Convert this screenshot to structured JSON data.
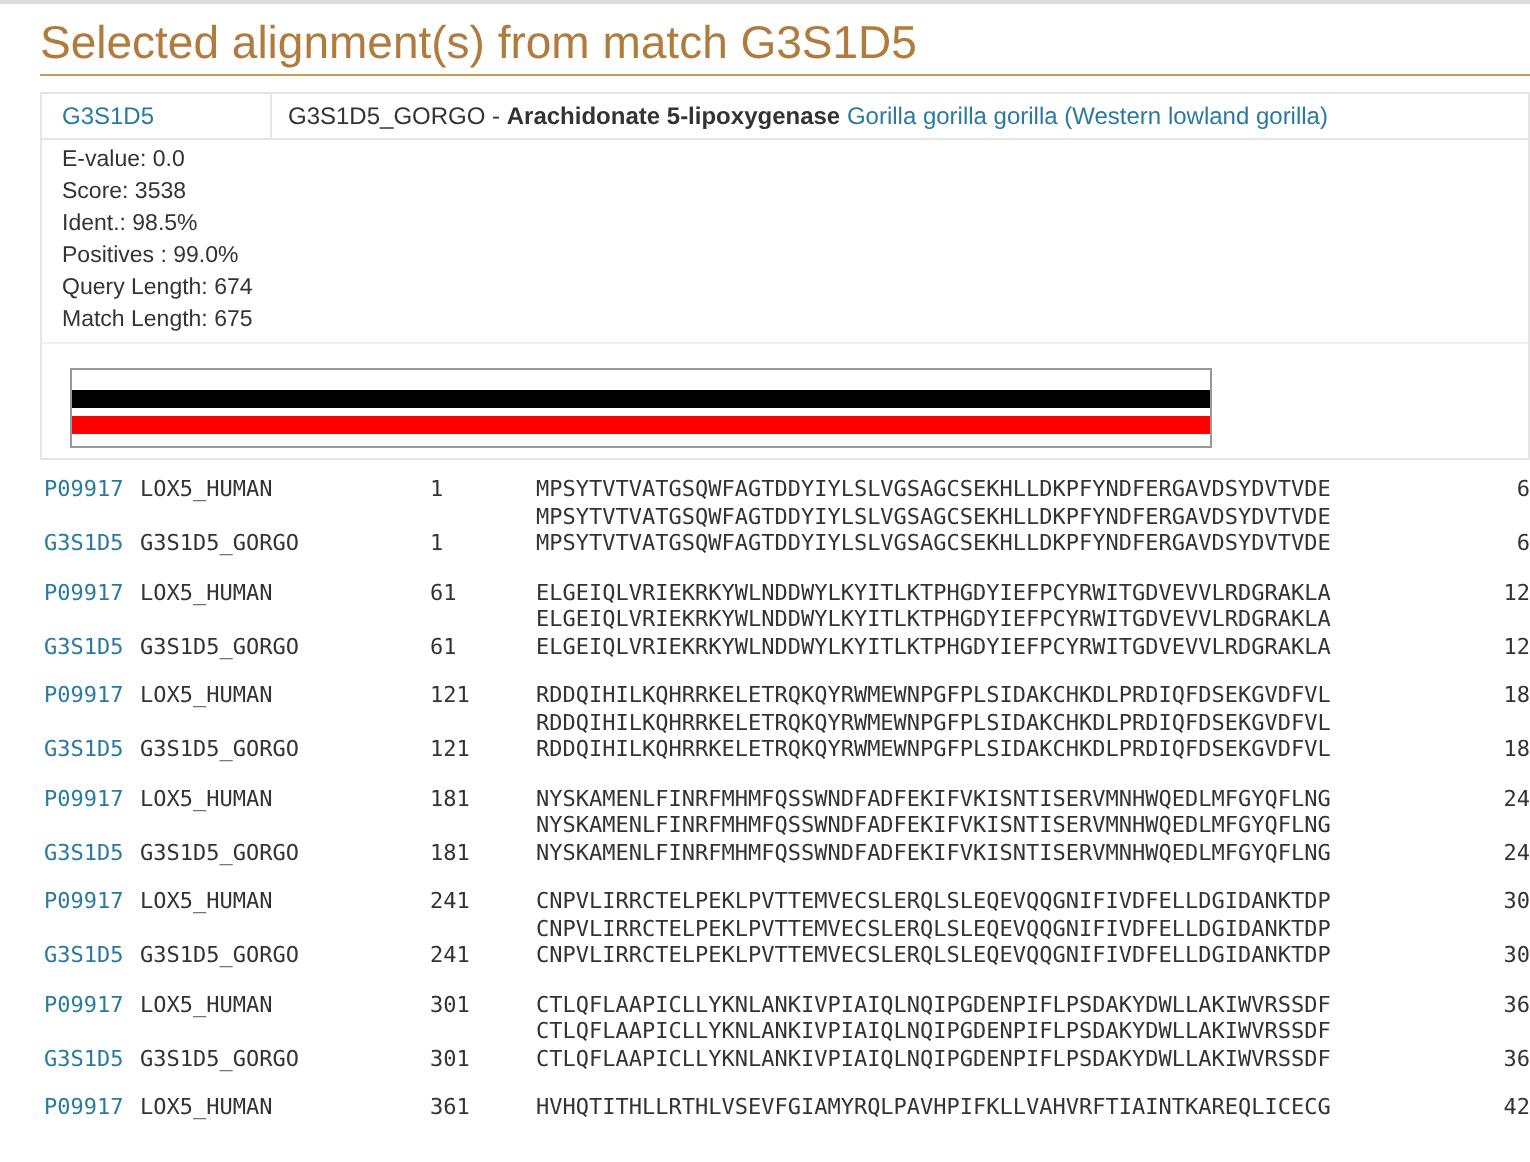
{
  "title": "Selected alignment(s) from match G3S1D5",
  "match": {
    "accession": "G3S1D5",
    "entry_name": "G3S1D5_GORGO",
    "separator": " - ",
    "protein": "Arachidonate 5-lipoxygenase",
    "organism": "Gorilla gorilla gorilla (Western lowland gorilla)"
  },
  "stats": [
    "E-value: 0.0",
    "Score: 3538",
    "Ident.: 98.5%",
    "Positives : 99.0%",
    "Query Length: 674",
    "Match Length: 675"
  ],
  "blocks": [
    {
      "query": {
        "accession": "P09917",
        "name": "LOX5_HUMAN",
        "start": "1",
        "sequence": "MPSYTVTVATGSQWFAGTDDYIYLSLVGSAGCSEKHLLDKPFYNDFERGAVDSYDVTVDE",
        "end": "6"
      },
      "middle": "MPSYTVTVATGSQWFAGTDDYIYLSLVGSAGCSEKHLLDKPFYNDFERGAVDSYDVTVDE",
      "match": {
        "accession": "G3S1D5",
        "name": "G3S1D5_GORGO",
        "start": "1",
        "sequence": "MPSYTVTVATGSQWFAGTDDYIYLSLVGSAGCSEKHLLDKPFYNDFERGAVDSYDVTVDE",
        "end": "6"
      }
    },
    {
      "query": {
        "accession": "P09917",
        "name": "LOX5_HUMAN",
        "start": "61",
        "sequence": "ELGEIQLVRIEKRKYWLNDDWYLKYITLKTPHGDYIEFPCYRWITGDVEVVLRDGRAKLA",
        "end": "12"
      },
      "middle": "ELGEIQLVRIEKRKYWLNDDWYLKYITLKTPHGDYIEFPCYRWITGDVEVVLRDGRAKLA",
      "match": {
        "accession": "G3S1D5",
        "name": "G3S1D5_GORGO",
        "start": "61",
        "sequence": "ELGEIQLVRIEKRKYWLNDDWYLKYITLKTPHGDYIEFPCYRWITGDVEVVLRDGRAKLA",
        "end": "12"
      }
    },
    {
      "query": {
        "accession": "P09917",
        "name": "LOX5_HUMAN",
        "start": "121",
        "sequence": "RDDQIHILKQHRRKELETRQKQYRWMEWNPGFPLSIDAKCHKDLPRDIQFDSEKGVDFVL",
        "end": "18"
      },
      "middle": "RDDQIHILKQHRRKELETRQKQYRWMEWNPGFPLSIDAKCHKDLPRDIQFDSEKGVDFVL",
      "match": {
        "accession": "G3S1D5",
        "name": "G3S1D5_GORGO",
        "start": "121",
        "sequence": "RDDQIHILKQHRRKELETRQKQYRWMEWNPGFPLSIDAKCHKDLPRDIQFDSEKGVDFVL",
        "end": "18"
      }
    },
    {
      "query": {
        "accession": "P09917",
        "name": "LOX5_HUMAN",
        "start": "181",
        "sequence": "NYSKAMENLFINRFMHMFQSSWNDFADFEKIFVKISNTISERVMNHWQEDLMFGYQFLNG",
        "end": "24"
      },
      "middle": "NYSKAMENLFINRFMHMFQSSWNDFADFEKIFVKISNTISERVMNHWQEDLMFGYQFLNG",
      "match": {
        "accession": "G3S1D5",
        "name": "G3S1D5_GORGO",
        "start": "181",
        "sequence": "NYSKAMENLFINRFMHMFQSSWNDFADFEKIFVKISNTISERVMNHWQEDLMFGYQFLNG",
        "end": "24"
      }
    },
    {
      "query": {
        "accession": "P09917",
        "name": "LOX5_HUMAN",
        "start": "241",
        "sequence": "CNPVLIRRCTELPEKLPVTTEMVECSLERQLSLEQEVQQGNIFIVDFELLDGIDANKTDP",
        "end": "30"
      },
      "middle": "CNPVLIRRCTELPEKLPVTTEMVECSLERQLSLEQEVQQGNIFIVDFELLDGIDANKTDP",
      "match": {
        "accession": "G3S1D5",
        "name": "G3S1D5_GORGO",
        "start": "241",
        "sequence": "CNPVLIRRCTELPEKLPVTTEMVECSLERQLSLEQEVQQGNIFIVDFELLDGIDANKTDP",
        "end": "30"
      }
    },
    {
      "query": {
        "accession": "P09917",
        "name": "LOX5_HUMAN",
        "start": "301",
        "sequence": "CTLQFLAAPICLLYKNLANKIVPIAIQLNQIPGDENPIFLPSDAKYDWLLAKIWVRSSDF",
        "end": "36"
      },
      "middle": "CTLQFLAAPICLLYKNLANKIVPIAIQLNQIPGDENPIFLPSDAKYDWLLAKIWVRSSDF",
      "match": {
        "accession": "G3S1D5",
        "name": "G3S1D5_GORGO",
        "start": "301",
        "sequence": "CTLQFLAAPICLLYKNLANKIVPIAIQLNQIPGDENPIFLPSDAKYDWLLAKIWVRSSDF",
        "end": "36"
      }
    },
    {
      "query": {
        "accession": "P09917",
        "name": "LOX5_HUMAN",
        "start": "361",
        "sequence": "HVHQTITHLLRTHLVSEVFGIAMYRQLPAVHPIFKLLVAHVRFTIAINTKAREQLICECG",
        "end": "42"
      }
    }
  ]
}
